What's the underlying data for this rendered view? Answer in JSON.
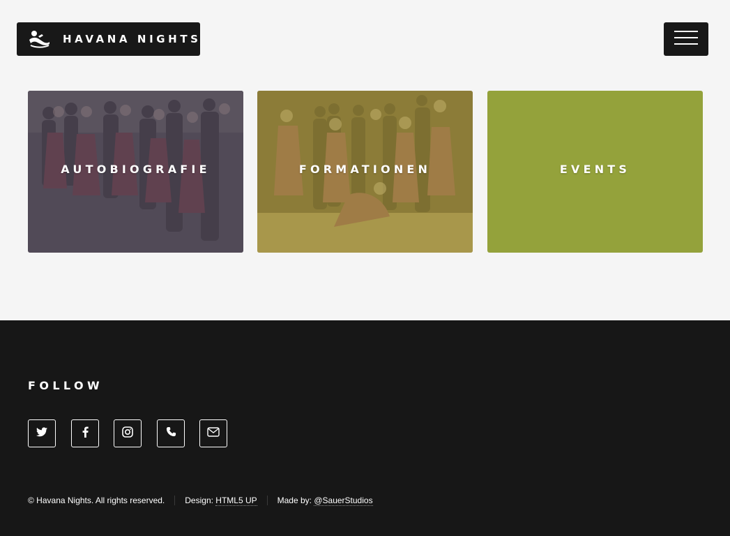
{
  "header": {
    "brand_title": "HAVANA NIGHTS",
    "brand_icon": "dancer-icon",
    "menu_icon": "hamburger-menu-icon"
  },
  "tiles": [
    {
      "label": "AUTOBIOGRAFIE",
      "overlay_color": "#4a4450"
    },
    {
      "label": "FORMATIONEN",
      "overlay_color": "#9b8a3c"
    },
    {
      "label": "EVENTS",
      "overlay_color": "#94a23b"
    }
  ],
  "footer": {
    "follow_heading": "FOLLOW",
    "social": [
      {
        "icon": "twitter-icon"
      },
      {
        "icon": "facebook-icon"
      },
      {
        "icon": "instagram-icon"
      },
      {
        "icon": "phone-icon"
      },
      {
        "icon": "email-icon"
      }
    ],
    "copyright": "© Havana Nights. All rights reserved.",
    "design_prefix": "Design: ",
    "design_link": "HTML5 UP",
    "made_prefix": "Made by: ",
    "made_link": "@SauerStudios"
  },
  "colors": {
    "background": "#f5f5f5",
    "footer": "#171717",
    "header_box": "#181818"
  }
}
